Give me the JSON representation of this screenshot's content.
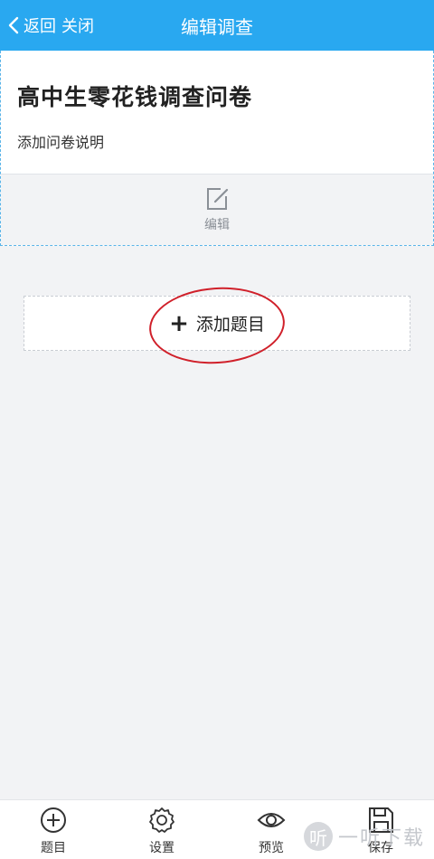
{
  "topbar": {
    "back_label": "返回",
    "close_label": "关闭",
    "title": "编辑调查",
    "bg_color": "#29a8f0"
  },
  "survey": {
    "title": "高中生零花钱调查问卷",
    "description": "添加问卷说明",
    "edit_label": "编辑",
    "edit_icon": "edit-icon"
  },
  "add_question": {
    "label": "添加题目",
    "icon": "plus-icon",
    "highlight_color": "#d0202a"
  },
  "bottom_nav": {
    "items": [
      {
        "label": "题目",
        "icon": "circle-plus-icon"
      },
      {
        "label": "设置",
        "icon": "gear-icon"
      },
      {
        "label": "预览",
        "icon": "eye-icon"
      },
      {
        "label": "保存",
        "icon": "floppy-disk-icon"
      }
    ]
  },
  "watermark": {
    "logo_char": "听",
    "text": "一听下载"
  }
}
